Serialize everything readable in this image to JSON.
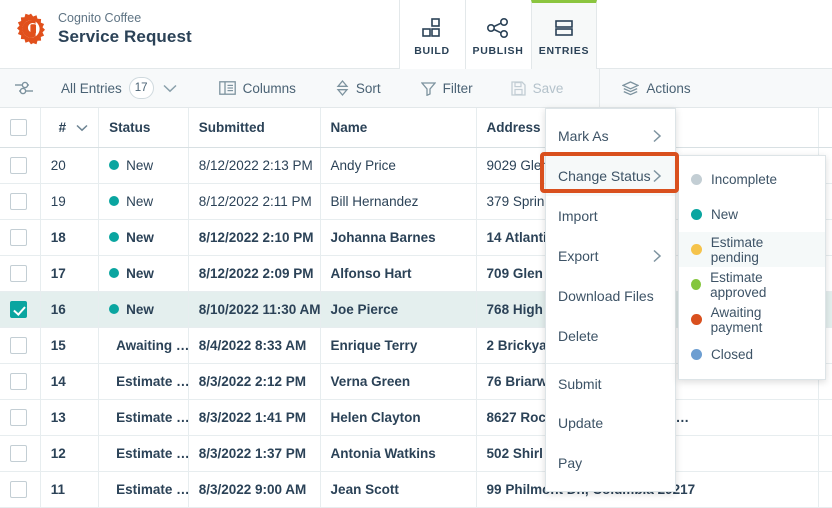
{
  "header": {
    "brand_sub": "Cognito Coffee",
    "brand_title": "Service Request",
    "logo_icon": "gear-logo-icon",
    "tabs": [
      {
        "label": "BUILD",
        "icon": "blocks-icon",
        "active": false
      },
      {
        "label": "PUBLISH",
        "icon": "share-nodes-icon",
        "active": false
      },
      {
        "label": "ENTRIES",
        "icon": "rows-icon",
        "active": true
      }
    ]
  },
  "toolbar": {
    "settings_icon": "sliders-icon",
    "view_label": "All Entries",
    "view_count": "17",
    "view_chevron_icon": "chevron-down-icon",
    "columns_label": "Columns",
    "columns_icon": "columns-icon",
    "sort_label": "Sort",
    "sort_icon": "sort-icon",
    "filter_label": "Filter",
    "filter_icon": "funnel-icon",
    "save_label": "Save",
    "save_icon": "floppy-disk-icon",
    "actions_label": "Actions",
    "actions_icon": "layers-icon"
  },
  "table": {
    "columns": [
      "",
      "#",
      "Status",
      "Submitted",
      "Name",
      "Address",
      ""
    ],
    "sort_indicator_icon": "chevron-down-icon",
    "rows": [
      {
        "checked": false,
        "num": "20",
        "status": "New",
        "status_color": "#0aa5a0",
        "submitted": "8/12/2022 2:13 PM",
        "name": "Andy Price",
        "address": "9029 Glen",
        "bold": false,
        "selected": false
      },
      {
        "checked": false,
        "num": "19",
        "status": "New",
        "status_color": "#0aa5a0",
        "submitted": "8/12/2022 2:11 PM",
        "name": "Bill Hernandez",
        "address": "379 Sprin",
        "bold": false,
        "selected": false
      },
      {
        "checked": false,
        "num": "18",
        "status": "New",
        "status_color": "#0aa5a0",
        "submitted": "8/12/2022 2:10 PM",
        "name": "Johanna Barnes",
        "address": "14 Atlanti",
        "bold": true,
        "selected": false
      },
      {
        "checked": false,
        "num": "17",
        "status": "New",
        "status_color": "#0aa5a0",
        "submitted": "8/12/2022 2:09 PM",
        "name": "Alfonso Hart",
        "address": "709 Glen",
        "bold": true,
        "selected": false
      },
      {
        "checked": true,
        "num": "16",
        "status": "New",
        "status_color": "#0aa5a0",
        "submitted": "8/10/2022 11:30 AM",
        "name": "Joe Pierce",
        "address": "768 High",
        "bold": true,
        "selected": true
      },
      {
        "checked": false,
        "num": "15",
        "status": "Awaiting …",
        "status_color": "#d9501e",
        "submitted": "8/4/2022 8:33 AM",
        "name": "Enrique Terry",
        "address": "2 Brickya",
        "bold": true,
        "selected": false
      },
      {
        "checked": false,
        "num": "14",
        "status": "Estimate …",
        "status_color": "#84c63c",
        "submitted": "8/3/2022 2:12 PM",
        "name": "Verna Green",
        "address": "76 Briarw",
        "bold": true,
        "selected": false
      },
      {
        "checked": false,
        "num": "13",
        "status": "Estimate …",
        "status_color": "#84c63c",
        "submitted": "8/3/2022 1:41 PM",
        "name": "Helen Clayton",
        "address": "8627 Roc                      ia, South Carolina 2…",
        "bold": true,
        "selected": false
      },
      {
        "checked": false,
        "num": "12",
        "status": "Estimate …",
        "status_color": "#84c63c",
        "submitted": "8/3/2022 1:37 PM",
        "name": "Antonia Watkins",
        "address": "502 Shirl                     1",
        "bold": true,
        "selected": false
      },
      {
        "checked": false,
        "num": "11",
        "status": "Estimate …",
        "status_color": "#84c63c",
        "submitted": "8/3/2022 9:00 AM",
        "name": "Jean Scott",
        "address": "99 Philmont Dr., Columbia 29217",
        "bold": true,
        "selected": false
      }
    ]
  },
  "actions_menu": {
    "items": [
      {
        "label": "Mark As",
        "has_arrow": true,
        "separator_above": false,
        "highlighted": false
      },
      {
        "label": "Change Status",
        "has_arrow": true,
        "separator_above": false,
        "highlighted": true
      },
      {
        "label": "Import",
        "has_arrow": false,
        "separator_above": false,
        "highlighted": false
      },
      {
        "label": "Export",
        "has_arrow": true,
        "separator_above": false,
        "highlighted": false
      },
      {
        "label": "Download Files",
        "has_arrow": false,
        "separator_above": false,
        "highlighted": false
      },
      {
        "label": "Delete",
        "has_arrow": false,
        "separator_above": false,
        "highlighted": false
      },
      {
        "label": "Submit",
        "has_arrow": false,
        "separator_above": true,
        "highlighted": false
      },
      {
        "label": "Update",
        "has_arrow": false,
        "separator_above": false,
        "highlighted": false
      },
      {
        "label": "Pay",
        "has_arrow": false,
        "separator_above": false,
        "highlighted": false
      }
    ],
    "arrow_icon": "chevron-right-icon",
    "highlight_color": "#d9501e"
  },
  "status_submenu": {
    "items": [
      {
        "label": "Incomplete",
        "color": "#c3ced4",
        "hover": false
      },
      {
        "label": "New",
        "color": "#0aa5a0",
        "hover": false
      },
      {
        "label": "Estimate pending",
        "color": "#f5c34b",
        "hover": true
      },
      {
        "label": "Estimate approved",
        "color": "#84c63c",
        "hover": false
      },
      {
        "label": "Awaiting payment",
        "color": "#d9501e",
        "hover": false
      },
      {
        "label": "Closed",
        "color": "#6d9ed1",
        "hover": false
      }
    ]
  }
}
